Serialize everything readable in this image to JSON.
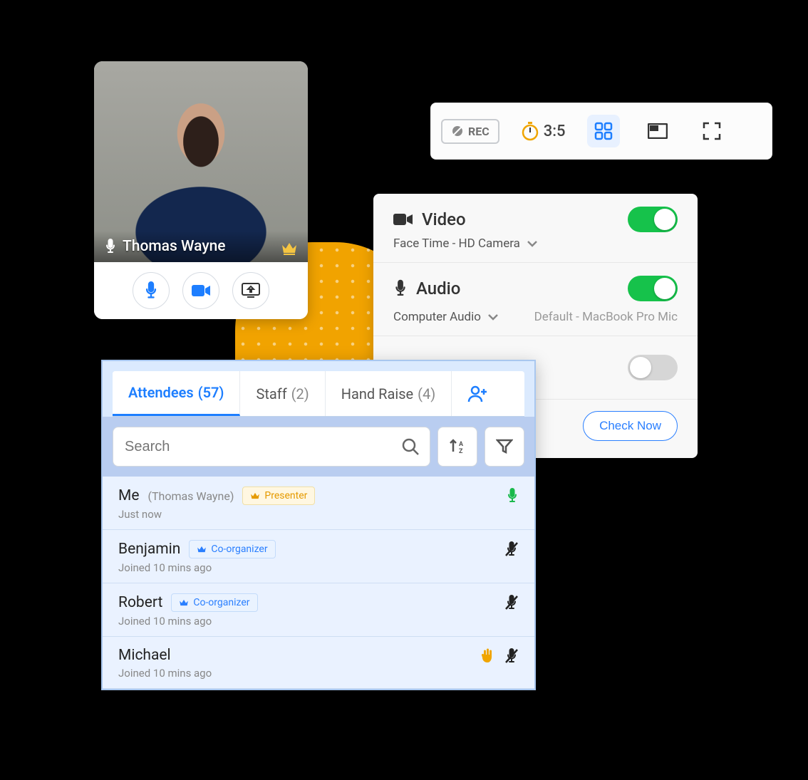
{
  "video_tile": {
    "name": "Thomas Wayne",
    "controls": {
      "mic": "microphone-icon",
      "cam": "camera-icon",
      "screen": "screenshare-icon"
    }
  },
  "toolbar": {
    "rec_label": "REC",
    "timer": "3:5"
  },
  "settings": {
    "video": {
      "label": "Video",
      "device": "Face Time - HD Camera",
      "on": true
    },
    "audio": {
      "label": "Audio",
      "device": "Computer Audio",
      "default_device": "Default - MacBook Pro Mic",
      "on": true
    },
    "third_toggle_on": false,
    "check_now_label": "Check Now"
  },
  "attendees": {
    "tabs": [
      {
        "label": "Attendees",
        "count": "(57)",
        "active": true
      },
      {
        "label": "Staff",
        "count": "(2)",
        "active": false
      },
      {
        "label": "Hand Raise",
        "count": "(4)",
        "active": false
      }
    ],
    "search_placeholder": "Search",
    "list": [
      {
        "name": "Me",
        "sub": "(Thomas Wayne)",
        "badge": "Presenter",
        "badge_type": "presenter",
        "meta": "Just now",
        "mic": "on",
        "hand": false
      },
      {
        "name": "Benjamin",
        "sub": "",
        "badge": "Co-organizer",
        "badge_type": "coorg",
        "meta": "Joined 10 mins ago",
        "mic": "muted",
        "hand": false
      },
      {
        "name": "Robert",
        "sub": "",
        "badge": "Co-organizer",
        "badge_type": "coorg",
        "meta": "Joined 10 mins ago",
        "mic": "muted",
        "hand": false
      },
      {
        "name": "Michael",
        "sub": "",
        "badge": "",
        "badge_type": "",
        "meta": "Joined 10 mins ago",
        "mic": "muted",
        "hand": true
      }
    ]
  }
}
